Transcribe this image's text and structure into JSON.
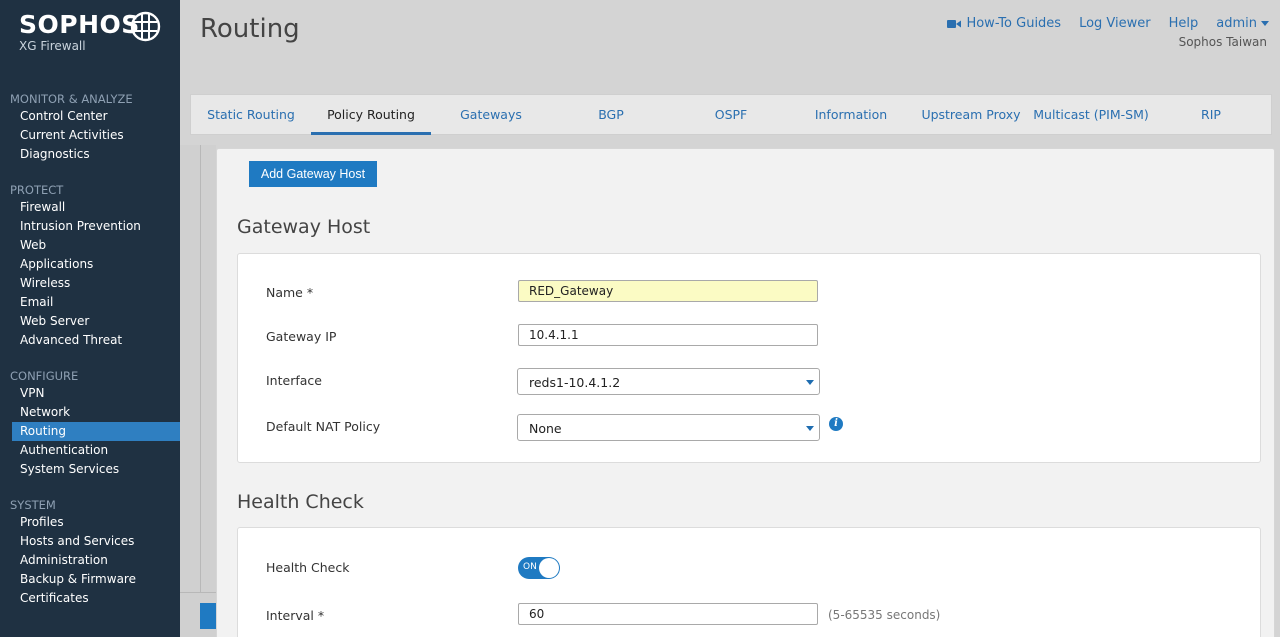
{
  "brand": {
    "name": "SOPHOS",
    "product": "XG Firewall"
  },
  "sidebar": {
    "sections": [
      {
        "heading": "MONITOR & ANALYZE",
        "items": [
          "Control Center",
          "Current Activities",
          "Diagnostics"
        ]
      },
      {
        "heading": "PROTECT",
        "items": [
          "Firewall",
          "Intrusion Prevention",
          "Web",
          "Applications",
          "Wireless",
          "Email",
          "Web Server",
          "Advanced Threat"
        ]
      },
      {
        "heading": "CONFIGURE",
        "items": [
          "VPN",
          "Network",
          "Routing",
          "Authentication",
          "System Services"
        ]
      },
      {
        "heading": "SYSTEM",
        "items": [
          "Profiles",
          "Hosts and Services",
          "Administration",
          "Backup & Firmware",
          "Certificates"
        ]
      }
    ],
    "active": "Routing"
  },
  "header": {
    "title": "Routing",
    "links": {
      "howto": "How-To Guides",
      "logviewer": "Log Viewer",
      "help": "Help",
      "user": "admin"
    },
    "org": "Sophos Taiwan"
  },
  "tabs": [
    "Static Routing",
    "Policy Routing",
    "Gateways",
    "BGP",
    "OSPF",
    "Information",
    "Upstream Proxy",
    "Multicast (PIM-SM)",
    "RIP"
  ],
  "active_tab": "Policy Routing",
  "actions": {
    "add_gateway_host": "Add Gateway Host"
  },
  "gateway_host": {
    "title": "Gateway Host",
    "name_label": "Name *",
    "name_value": "RED_Gateway",
    "ip_label": "Gateway IP",
    "ip_value": "10.4.1.1",
    "interface_label": "Interface",
    "interface_value": "reds1-10.4.1.2",
    "nat_label": "Default NAT Policy",
    "nat_value": "None",
    "info_glyph": "i"
  },
  "health_check": {
    "title": "Health Check",
    "toggle_label": "Health Check",
    "toggle_state": "ON",
    "interval_label": "Interval *",
    "interval_value": "60",
    "interval_hint": "(5-65535 seconds)"
  },
  "colors": {
    "sidebar": "#1f3142",
    "accent": "#1f7ac2",
    "link": "#2a6fb0"
  },
  "icons": [
    "globe-logo-icon",
    "video-camera-icon",
    "chevron-down-icon",
    "info-icon"
  ]
}
